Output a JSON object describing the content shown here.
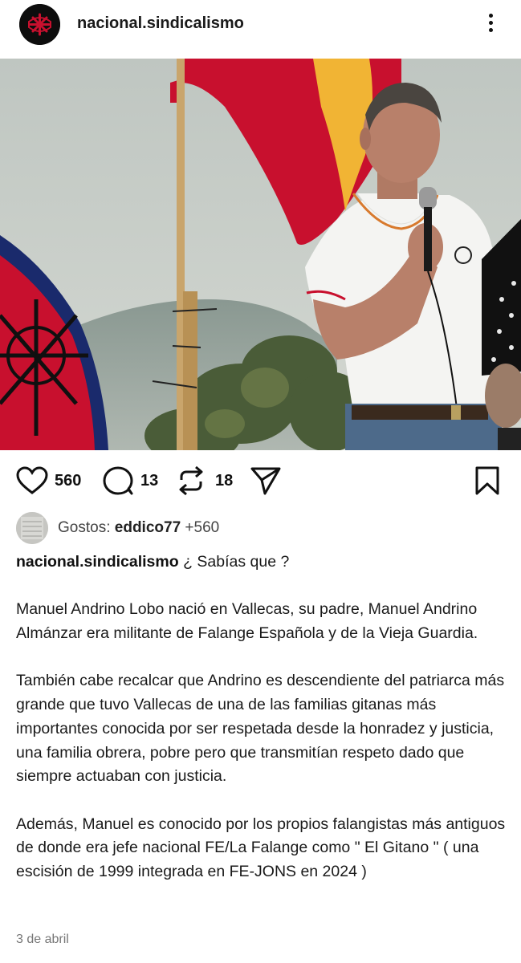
{
  "header": {
    "username": "nacional.sindicalismo",
    "more_icon": "more-vertical-icon"
  },
  "post": {
    "image_icon": "photo"
  },
  "actions": {
    "likes": "560",
    "comments": "13",
    "reposts": "18"
  },
  "likes_row": {
    "prefix": "Gostos:",
    "user": "eddico77",
    "suffix": "+560"
  },
  "caption": {
    "username": "nacional.sindicalismo",
    "first_line": " ¿ Sabías que ?",
    "paragraphs": [
      "Manuel Andrino Lobo nació en Vallecas, su padre, Manuel Andrino Almánzar era militante de Falange Española y de la Vieja Guardia.",
      "También cabe recalcar que Andrino es descendiente del patriarca más grande que tuvo Vallecas de una de las familias gitanas más importantes conocida por ser respetada desde la honradez y justicia, una familia obrera, pobre pero que transmitían respeto dado que siempre actuaban con justicia.",
      "Además, Manuel es conocido por los propios falangistas más antiguos de donde era jefe nacional FE/La Falange como \" El Gitano \" ( una escisión de 1999 integrada en FE-JONS en 2024 )"
    ]
  },
  "date": "3 de abril",
  "colors": {
    "flag_red": "#c8102e",
    "flag_yellow": "#f1b434",
    "shirt_white": "#f4f4f2",
    "sky": "#c9d0cc"
  }
}
